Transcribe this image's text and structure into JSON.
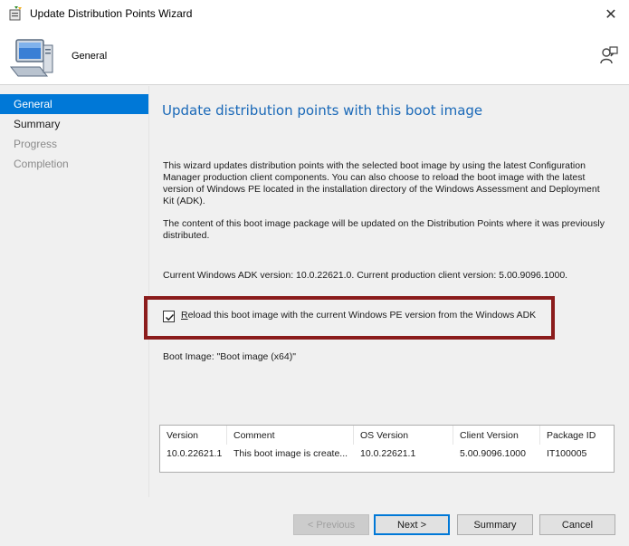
{
  "window": {
    "title": "Update Distribution Points Wizard",
    "close_glyph": "✕"
  },
  "header": {
    "title": "General"
  },
  "nav": {
    "items": [
      {
        "label": "General",
        "state": "selected"
      },
      {
        "label": "Summary",
        "state": "enabled"
      },
      {
        "label": "Progress",
        "state": "disabled"
      },
      {
        "label": "Completion",
        "state": "disabled"
      }
    ]
  },
  "main": {
    "heading": "Update distribution points with this boot image",
    "paragraph1": "This wizard updates distribution points with the selected boot image by using the latest Configuration Manager production client components. You can also choose to reload the boot image with the latest version of Windows PE located in the installation directory of the Windows Assessment and Deployment Kit (ADK).",
    "paragraph2": "The content of this boot image package will be updated on the Distribution Points where it was previously distributed.",
    "version_info": "Current Windows ADK version: 10.0.22621.0. Current production client version: 5.00.9096.1000.",
    "checkbox": {
      "checked": true,
      "label_accel": "R",
      "label_rest": "eload this boot image with the current Windows PE version from the Windows ADK"
    },
    "boot_image": "Boot Image: \"Boot image (x64)\""
  },
  "table": {
    "columns": [
      "Version",
      "Comment",
      "OS Version",
      "Client Version",
      "Package ID"
    ],
    "rows": [
      [
        "10.0.22621.1",
        "This boot image is create...",
        "10.0.22621.1",
        "5.00.9096.1000",
        "IT100005"
      ]
    ]
  },
  "buttons": {
    "previous": "< Previous",
    "next": "Next >",
    "summary": "Summary",
    "cancel": "Cancel"
  },
  "colors": {
    "accent": "#0078d7",
    "heading": "#1a69b8",
    "highlight_frame": "#8b1c1c"
  },
  "icons": [
    "wizard-app-icon",
    "computer-icon",
    "help-person-icon",
    "check-icon"
  ]
}
